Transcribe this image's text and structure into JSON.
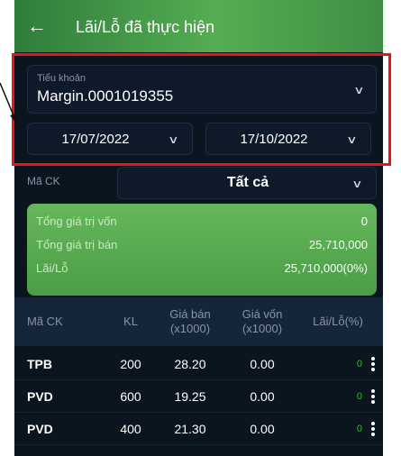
{
  "header": {
    "back_icon": "arrow-left-icon",
    "title": "Lãi/Lỗ đã thực hiện"
  },
  "account": {
    "label": "Tiểu khoản",
    "value": "Margin.0001019355"
  },
  "date_from": "17/07/2022",
  "date_to": "17/10/2022",
  "symbol_filter": {
    "label": "Mã CK",
    "value": "Tất cả"
  },
  "summary": {
    "cost_label": "Tổng giá trị vốn",
    "cost_value": "0",
    "sell_label": "Tổng giá trị bán",
    "sell_value": "25,710,000",
    "pl_label": "Lãi/Lỗ",
    "pl_value": "25,710,000(0%)"
  },
  "table": {
    "headers": [
      "Mã CK",
      "KL",
      "Giá bán\n(x1000)",
      "Giá vốn\n(x1000)",
      "Lãi/Lỗ(%)"
    ],
    "rows": [
      {
        "symbol": "TPB",
        "qty": "200",
        "sell": "28.20",
        "cost": "0.00",
        "pl": "0"
      },
      {
        "symbol": "PVD",
        "qty": "600",
        "sell": "19.25",
        "cost": "0.00",
        "pl": "0"
      },
      {
        "symbol": "PVD",
        "qty": "400",
        "sell": "21.30",
        "cost": "0.00",
        "pl": "0"
      }
    ]
  },
  "colors": {
    "header_green": "#55ad52",
    "highlight_red": "#e3171b",
    "profit_green": "#2ebd2e"
  }
}
